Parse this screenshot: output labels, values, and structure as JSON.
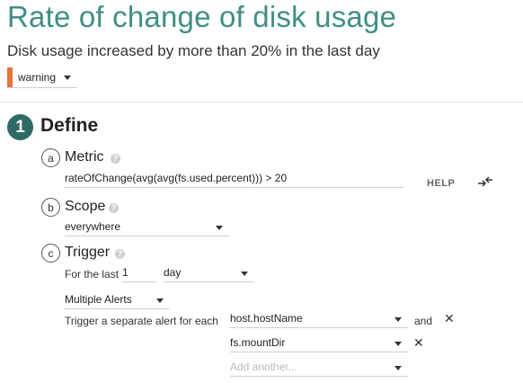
{
  "header": {
    "title": "Rate of change of disk usage",
    "subtitle": "Disk usage increased by more than 20% in the last day"
  },
  "severity": {
    "value": "warning",
    "color": "#e8743b"
  },
  "define": {
    "step_number": "1",
    "title": "Define",
    "metric": {
      "letter": "a",
      "title": "Metric",
      "query": "rateOfChange(avg(avg(fs.used.percent))) > 20",
      "help_label": "HELP"
    },
    "scope": {
      "letter": "b",
      "title": "Scope",
      "value": "everywhere"
    },
    "trigger": {
      "letter": "c",
      "title": "Trigger",
      "for_the_last_label": "For the last",
      "duration_value": "1",
      "duration_unit": "day",
      "alert_mode": "Multiple Alerts",
      "separate_label": "Trigger a separate alert for each",
      "segment_1": "host.hostName",
      "and_label": "and",
      "segment_2": "fs.mountDir",
      "add_placeholder": "Add another..."
    }
  },
  "icons": {
    "help_icon": "question-circle",
    "expand_icon": "arrows-collapse",
    "remove_icon": "close-x"
  }
}
